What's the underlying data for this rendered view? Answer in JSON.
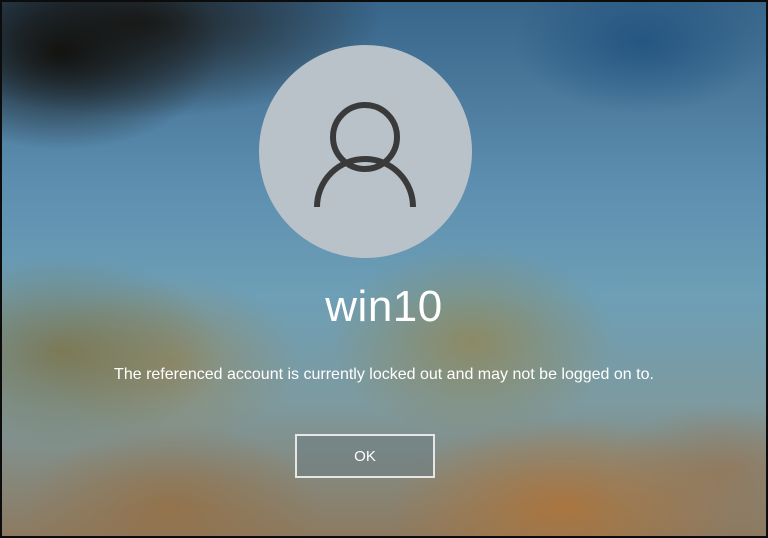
{
  "account": {
    "username": "win10",
    "avatar_icon": "user-silhouette-icon"
  },
  "error": {
    "message": "The referenced account is currently locked out and may not be logged on to."
  },
  "actions": {
    "ok_label": "OK"
  },
  "colors": {
    "avatar_background": "#b9c2c8",
    "avatar_glyph": "#3a3a3a",
    "text": "#ffffff",
    "button_border": "#e6e6e6"
  }
}
